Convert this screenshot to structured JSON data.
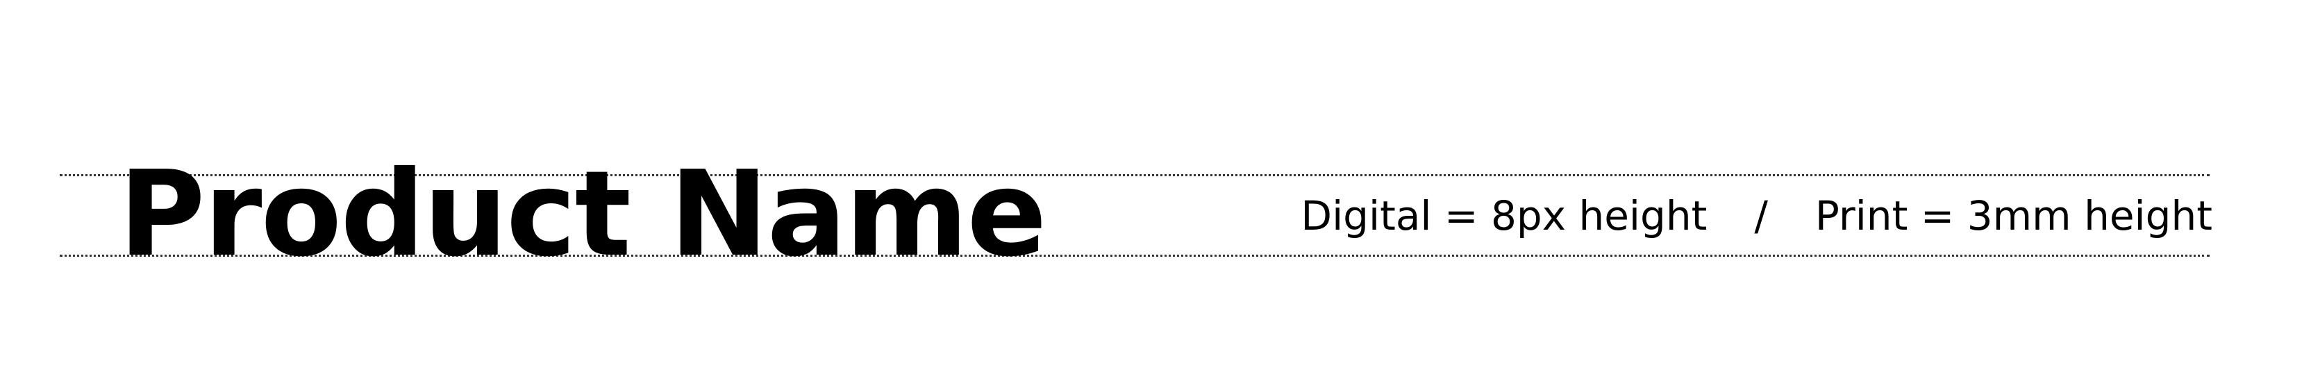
{
  "heading": {
    "text": "Product Name"
  },
  "spec": {
    "digital": "Digital = 8px height",
    "separator": "/",
    "print": "Print = 3mm height"
  }
}
